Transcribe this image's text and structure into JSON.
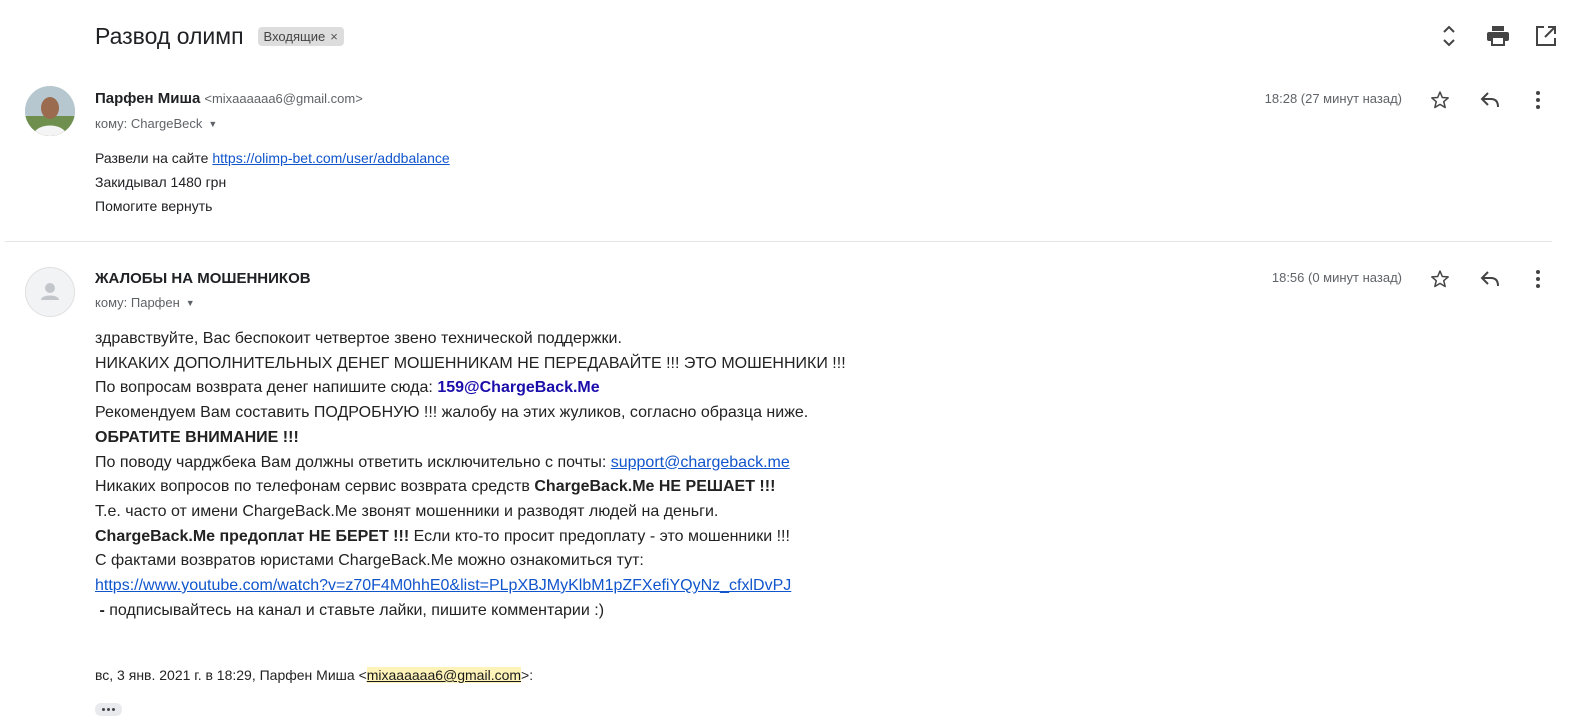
{
  "thread": {
    "subject": "Развод олимп",
    "label": "Входящие",
    "label_remove": "×"
  },
  "toolbar": {
    "expand_icon": "unfold-icon",
    "print_icon": "print-icon",
    "open_icon": "open-new-window-icon"
  },
  "messages": [
    {
      "sender_name": "Парфен Миша",
      "sender_email": "<mixaaaaaa6@gmail.com>",
      "to": "кому: ChargeBeck",
      "time": "18:28 (27 минут назад)",
      "body": {
        "line1_prefix": "Развели на сайте ",
        "line1_link": "https://olimp-bet.com/user/addbalance",
        "line2": "Закидывал 1480 грн",
        "line3": "Помогите вернуть"
      }
    },
    {
      "sender_name": "ЖАЛОБЫ НА МОШЕННИКОВ",
      "to": "кому: Парфен",
      "time": "18:56 (0 минут назад)",
      "body": {
        "l1": "здравствуйте, Вас беспокоит четвертое звено технической поддержки.",
        "l2": "НИКАКИХ ДОПОЛНИТЕЛЬНЫХ ДЕНЕГ МОШЕННИКАМ НЕ ПЕРЕДАВАЙТЕ !!! ЭТО МОШЕННИКИ !!!",
        "l3_prefix": "По вопросам возврата денег напишите сюда: ",
        "l3_email": "159@ChargeBack.Me",
        "l4": "Рекомендуем Вам составить ПОДРОБНУЮ !!! жалобу на этих жуликов, согласно образца ниже.",
        "l5": "ОБРАТИТЕ ВНИМАНИЕ !!!",
        "l6_prefix": "По поводу чарджбека Вам должны ответить исключительно с почты: ",
        "l6_link": "support@chargeback.me",
        "l7_prefix": "Никаких вопросов по телефонам сервис возврата средств ",
        "l7_bold": "ChargeBack.Me НЕ РЕШАЕТ !!!",
        "l8": "Т.е. часто от имени ChargeBack.Me звонят мошенники и разводят людей на деньги.",
        "l9_bold": "ChargeBack.Me предоплат НЕ БЕРЕТ !!!",
        "l9_rest": " Если кто-то просит предоплату - это мошенники !!!",
        "l10": "С фактами возвратов юристами ChargeBack.Me можно ознакомиться тут:",
        "l11_link": "https://www.youtube.com/watch?v=z70F4M0hhE0&list=PLpXBJMyKlbM1pZFXefiYQyNz_cfxlDvPJ",
        "l12_dash": " - ",
        "l12_rest": "подписывайтесь на канал и ставьте лайки, пишите комментарии :)"
      },
      "quote": {
        "prefix": "вс, 3 янв. 2021 г. в 18:29, Парфен Миша <",
        "email": "mixaaaaaa6@gmail.com",
        "suffix": ">:"
      }
    }
  ]
}
